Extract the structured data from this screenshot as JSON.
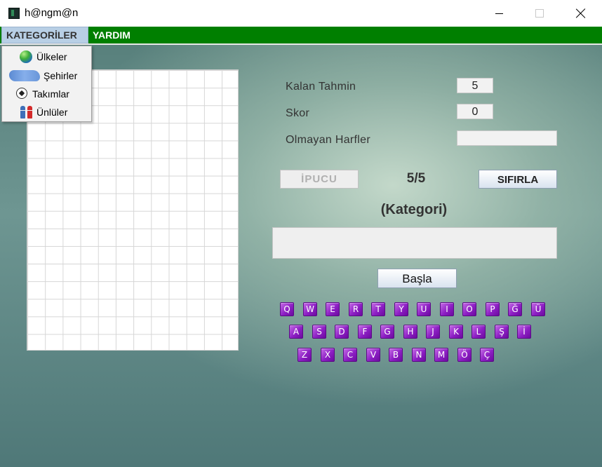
{
  "window": {
    "title": "h@ngm@n"
  },
  "menu": {
    "kategoriler": "KATEGORİLER",
    "yardim": "YARDIM"
  },
  "dropdown": [
    {
      "label": "Ülkeler",
      "icon": "globe-icon"
    },
    {
      "label": "Şehirler",
      "icon": "map-icon"
    },
    {
      "label": "Takımlar",
      "icon": "soccer-ball-icon"
    },
    {
      "label": "Ünlüler",
      "icon": "people-icon"
    }
  ],
  "stats": {
    "kalan_label": "Kalan Tahmin",
    "kalan_value": "5",
    "skor_label": "Skor",
    "skor_value": "0",
    "olmayan_label": "Olmayan Harfler",
    "olmayan_value": ""
  },
  "controls": {
    "ipucu": "İPUCU",
    "counter": "5/5",
    "sifirla": "SIFIRLA",
    "category": "(Kategori)",
    "word": "",
    "basla": "Başla"
  },
  "keyboard": {
    "row1": [
      "Q",
      "W",
      "E",
      "R",
      "T",
      "Y",
      "U",
      "I",
      "O",
      "P",
      "Ğ",
      "Ü"
    ],
    "row2": [
      "A",
      "S",
      "D",
      "F",
      "G",
      "H",
      "J",
      "K",
      "L",
      "Ş",
      "İ"
    ],
    "row3": [
      "Z",
      "X",
      "C",
      "V",
      "B",
      "N",
      "M",
      "Ö",
      "Ç"
    ]
  },
  "colors": {
    "menubar": "#007f00",
    "key_purple": "#8d1fc4"
  }
}
